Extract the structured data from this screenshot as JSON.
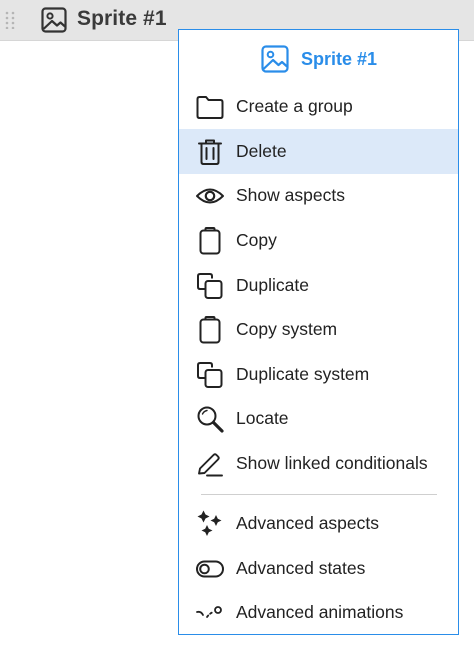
{
  "row": {
    "label": "Sprite #1",
    "icon": "image-icon",
    "handle_icon": "drag-handle-icon"
  },
  "menu": {
    "title": "Sprite #1",
    "title_icon": "image-icon",
    "accent_color": "#2a8de9",
    "active_bg": "#dce9f9",
    "items": [
      {
        "label": "Create a group",
        "icon": "folder-icon",
        "active": false
      },
      {
        "label": "Delete",
        "icon": "trash-icon",
        "active": true
      },
      {
        "label": "Show aspects",
        "icon": "eye-icon",
        "active": false
      },
      {
        "label": "Copy",
        "icon": "clipboard-icon",
        "active": false
      },
      {
        "label": "Duplicate",
        "icon": "duplicate-icon",
        "active": false
      },
      {
        "label": "Copy system",
        "icon": "clipboard-icon",
        "active": false
      },
      {
        "label": "Duplicate system",
        "icon": "duplicate-icon",
        "active": false
      },
      {
        "label": "Locate",
        "icon": "magnifier-icon",
        "active": false
      },
      {
        "label": "Show linked conditionals",
        "icon": "pencil-icon",
        "active": false
      },
      {
        "label": "Advanced aspects",
        "icon": "sparkles-icon",
        "active": false
      },
      {
        "label": "Advanced states",
        "icon": "toggle-icon",
        "active": false
      },
      {
        "label": "Advanced animations",
        "icon": "motion-curve-icon",
        "active": false
      }
    ]
  }
}
